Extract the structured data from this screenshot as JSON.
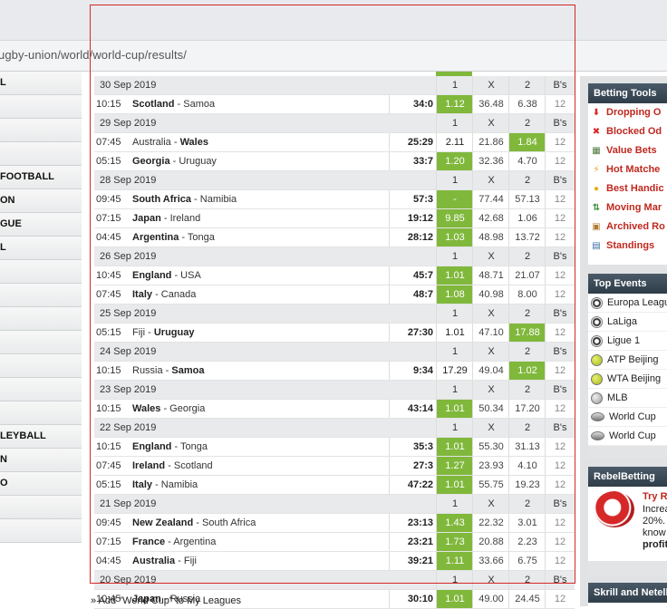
{
  "browser": {
    "url_fragment": "ugby-union/world/world-cup/results/"
  },
  "left_nav": {
    "items": [
      "L",
      "",
      "",
      "",
      "FOOTBALL",
      "ON",
      "GUE",
      "L",
      "",
      "",
      "",
      "",
      "",
      "",
      "",
      "LEYBALL",
      "N",
      "O",
      "",
      ""
    ]
  },
  "results": {
    "header": {
      "one": "1",
      "x": "X",
      "two": "2",
      "bs": "B's"
    },
    "groups": [
      {
        "date": "30 Sep 2019",
        "matches": [
          {
            "time": "10:15",
            "home": "Scotland",
            "away": "Samoa",
            "winner": "home",
            "score": "34:0",
            "o1": "1.12",
            "ox": "36.48",
            "o2": "6.38",
            "bs": "12",
            "win": "1"
          }
        ]
      },
      {
        "date": "29 Sep 2019",
        "matches": [
          {
            "time": "07:45",
            "home": "Australia",
            "away": "Wales",
            "winner": "away",
            "score": "25:29",
            "o1": "2.11",
            "ox": "21.86",
            "o2": "1.84",
            "bs": "12",
            "win": "2"
          },
          {
            "time": "05:15",
            "home": "Georgia",
            "away": "Uruguay",
            "winner": "home",
            "score": "33:7",
            "o1": "1.20",
            "ox": "32.36",
            "o2": "4.70",
            "bs": "12",
            "win": "1"
          }
        ]
      },
      {
        "date": "28 Sep 2019",
        "matches": [
          {
            "time": "09:45",
            "home": "South Africa",
            "away": "Namibia",
            "winner": "home",
            "score": "57:3",
            "o1": "-",
            "ox": "77.44",
            "o2": "57.13",
            "bs": "12",
            "win": "1"
          },
          {
            "time": "07:15",
            "home": "Japan",
            "away": "Ireland",
            "winner": "home",
            "score": "19:12",
            "o1": "9.85",
            "ox": "42.68",
            "o2": "1.06",
            "bs": "12",
            "win": "1"
          },
          {
            "time": "04:45",
            "home": "Argentina",
            "away": "Tonga",
            "winner": "home",
            "score": "28:12",
            "o1": "1.03",
            "ox": "48.98",
            "o2": "13.72",
            "bs": "12",
            "win": "1"
          }
        ]
      },
      {
        "date": "26 Sep 2019",
        "matches": [
          {
            "time": "10:45",
            "home": "England",
            "away": "USA",
            "winner": "home",
            "score": "45:7",
            "o1": "1.01",
            "ox": "48.71",
            "o2": "21.07",
            "bs": "12",
            "win": "1"
          },
          {
            "time": "07:45",
            "home": "Italy",
            "away": "Canada",
            "winner": "home",
            "score": "48:7",
            "o1": "1.08",
            "ox": "40.98",
            "o2": "8.00",
            "bs": "12",
            "win": "1"
          }
        ]
      },
      {
        "date": "25 Sep 2019",
        "matches": [
          {
            "time": "05:15",
            "home": "Fiji",
            "away": "Uruguay",
            "winner": "away",
            "score": "27:30",
            "o1": "1.01",
            "ox": "47.10",
            "o2": "17.88",
            "bs": "12",
            "win": "2"
          }
        ]
      },
      {
        "date": "24 Sep 2019",
        "matches": [
          {
            "time": "10:15",
            "home": "Russia",
            "away": "Samoa",
            "winner": "away",
            "score": "9:34",
            "o1": "17.29",
            "ox": "49.04",
            "o2": "1.02",
            "bs": "12",
            "win": "2"
          }
        ]
      },
      {
        "date": "23 Sep 2019",
        "matches": [
          {
            "time": "10:15",
            "home": "Wales",
            "away": "Georgia",
            "winner": "home",
            "score": "43:14",
            "o1": "1.01",
            "ox": "50.34",
            "o2": "17.20",
            "bs": "12",
            "win": "1"
          }
        ]
      },
      {
        "date": "22 Sep 2019",
        "matches": [
          {
            "time": "10:15",
            "home": "England",
            "away": "Tonga",
            "winner": "home",
            "score": "35:3",
            "o1": "1.01",
            "ox": "55.30",
            "o2": "31.13",
            "bs": "12",
            "win": "1"
          },
          {
            "time": "07:45",
            "home": "Ireland",
            "away": "Scotland",
            "winner": "home",
            "score": "27:3",
            "o1": "1.27",
            "ox": "23.93",
            "o2": "4.10",
            "bs": "12",
            "win": "1"
          },
          {
            "time": "05:15",
            "home": "Italy",
            "away": "Namibia",
            "winner": "home",
            "score": "47:22",
            "o1": "1.01",
            "ox": "55.75",
            "o2": "19.23",
            "bs": "12",
            "win": "1"
          }
        ]
      },
      {
        "date": "21 Sep 2019",
        "matches": [
          {
            "time": "09:45",
            "home": "New Zealand",
            "away": "South Africa",
            "winner": "home",
            "score": "23:13",
            "o1": "1.43",
            "ox": "22.32",
            "o2": "3.01",
            "bs": "12",
            "win": "1"
          },
          {
            "time": "07:15",
            "home": "France",
            "away": "Argentina",
            "winner": "home",
            "score": "23:21",
            "o1": "1.73",
            "ox": "20.88",
            "o2": "2.23",
            "bs": "12",
            "win": "1"
          },
          {
            "time": "04:45",
            "home": "Australia",
            "away": "Fiji",
            "winner": "home",
            "score": "39:21",
            "o1": "1.11",
            "ox": "33.66",
            "o2": "6.75",
            "bs": "12",
            "win": "1"
          }
        ]
      },
      {
        "date": "20 Sep 2019",
        "matches": [
          {
            "time": "10:45",
            "home": "Japan",
            "away": "Russia",
            "winner": "home",
            "score": "30:10",
            "o1": "1.01",
            "ox": "49.00",
            "o2": "24.45",
            "bs": "12",
            "win": "1"
          }
        ]
      }
    ],
    "add_league_label": "Add \"World Cup\" to My Leagues",
    "add_league_arrow": "»"
  },
  "sidebar": {
    "betting_tools_title": "Betting Tools",
    "tools": [
      {
        "label": "Dropping O",
        "icon": "down-arrow-icon"
      },
      {
        "label": "Blocked Od",
        "icon": "blocked-x-icon"
      },
      {
        "label": "Value Bets",
        "icon": "chart-icon"
      },
      {
        "label": "Hot Matche",
        "icon": "lightning-icon"
      },
      {
        "label": "Best Handic",
        "icon": "coin-icon"
      },
      {
        "label": "Moving Mar",
        "icon": "up-down-arrows-icon"
      },
      {
        "label": "Archived Ro",
        "icon": "archive-icon"
      },
      {
        "label": "Standings",
        "icon": "table-icon"
      }
    ],
    "top_events_title": "Top Events",
    "events": [
      {
        "label": "Europa Leagu",
        "icon": "soccer-ball-icon"
      },
      {
        "label": "LaLiga",
        "icon": "soccer-ball-icon"
      },
      {
        "label": "Ligue 1",
        "icon": "soccer-ball-icon"
      },
      {
        "label": "ATP Beijing",
        "icon": "tennis-ball-icon"
      },
      {
        "label": "WTA Beijing",
        "icon": "tennis-ball-icon"
      },
      {
        "label": "MLB",
        "icon": "baseball-icon"
      },
      {
        "label": "World Cup",
        "icon": "rugby-ball-icon"
      },
      {
        "label": "World Cup",
        "icon": "rugby-ball-icon"
      }
    ],
    "rebel_title": "RebelBetting",
    "rebel_link": "Try R",
    "rebel_lines": [
      "Increa",
      "20%.",
      "know",
      "profit"
    ],
    "skrill_title": "Skrill and Neteller"
  },
  "colors": {
    "win_green": "#80b83c",
    "accent_red": "#c0281e",
    "header_dark": "#2f3d49"
  }
}
